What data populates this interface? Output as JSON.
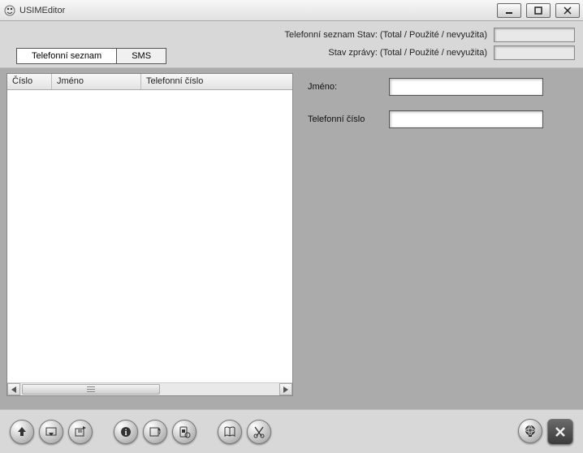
{
  "window": {
    "title": "USIMEditor"
  },
  "status": {
    "phonebook_label": "Telefonní seznam Stav: (Total / Použité / nevyužita)",
    "phonebook_value": "",
    "sms_label": "Stav zprávy: (Total / Použité / nevyužita)",
    "sms_value": ""
  },
  "tabs": {
    "phonebook": "Telefonní seznam",
    "sms": "SMS"
  },
  "table": {
    "col_number": "Číslo",
    "col_name": "Jméno",
    "col_phone": "Telefonní číslo",
    "rows": []
  },
  "form": {
    "name_label": "Jméno:",
    "name_value": "",
    "phone_label": "Telefonní číslo",
    "phone_value": ""
  },
  "toolbar": {
    "upload": "upload",
    "download": "download",
    "new": "new-entry",
    "info": "info",
    "refresh": "refresh",
    "sim": "sim-settings",
    "book": "address-book",
    "cut": "cut",
    "globe": "globe",
    "close": "close"
  }
}
